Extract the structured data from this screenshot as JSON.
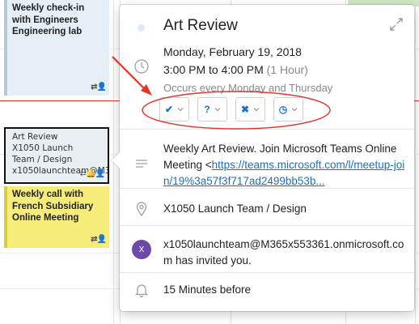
{
  "calendar": {
    "events": [
      {
        "lines": [
          "Weekly check-in",
          "with Engineers",
          "Engineering lab"
        ],
        "icons": "⇄👤"
      },
      {
        "lines": [
          "Art Review",
          "X1050 Launch",
          "Team / Design",
          "x1050launchteam@M3"
        ],
        "icons": "⇄🔔👤"
      },
      {
        "lines": [
          "Weekly call with",
          "French Subsidiary",
          "Online Meeting"
        ],
        "icons": "⇄👤"
      }
    ]
  },
  "popup": {
    "title": "Art Review",
    "date": "Monday, February 19, 2018",
    "time": "3:00 PM to 4:00 PM",
    "duration": "(1 Hour)",
    "recurrence": "Occurs every Monday and Thursday",
    "rsvp": [
      {
        "id": "accept",
        "glyph": "✔",
        "icon": "checkmark-icon"
      },
      {
        "id": "tentative",
        "glyph": "?",
        "icon": "question-icon"
      },
      {
        "id": "decline",
        "glyph": "✖",
        "icon": "x-icon"
      },
      {
        "id": "propose-time",
        "glyph": "◷",
        "icon": "clock-icon"
      }
    ],
    "description_text": "Weekly Art Review.    Join Microsoft Teams Online Meeting <",
    "description_link": "https://teams.microsoft.com/l/meetup-join/19%3a57f3f717ad2499bb53b...",
    "location": "X1050 Launch Team / Design",
    "avatar_initial": "X",
    "inviter_email": "x1050launchteam@M365x553361.onmicrosoft.com",
    "inviter_suffix": " has invited you.",
    "reminder": "15 Minutes before"
  },
  "colors": {
    "accent": "#1a73c9",
    "annotation": "#e5332a",
    "event_blue": "#e6eef6",
    "event_yellow": "#f5ec7a",
    "avatar": "#6b4aa8"
  }
}
